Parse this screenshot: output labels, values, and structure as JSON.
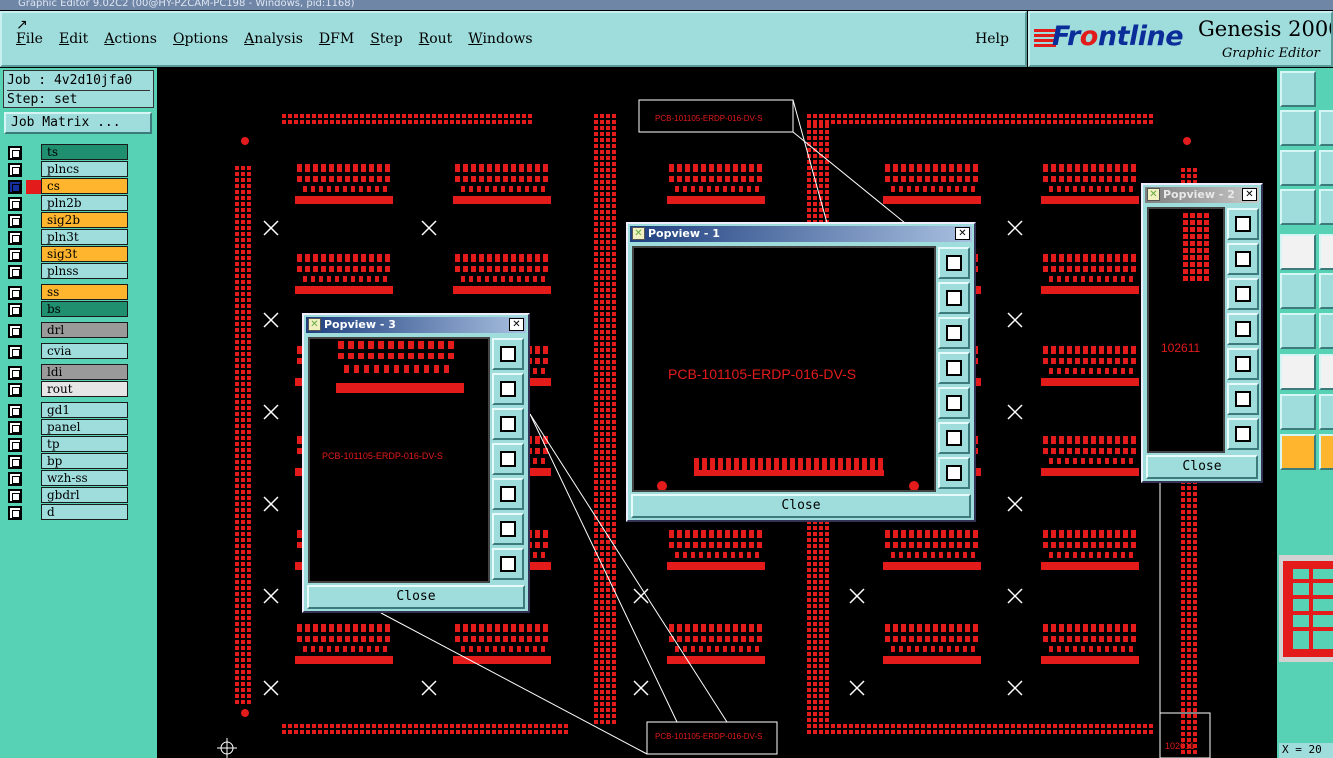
{
  "window": {
    "title": "Graphic Editor 9.02C2 (00@HY-PZCAM-PC198 - Windows, pid:1168)"
  },
  "menu": {
    "items": [
      {
        "label": "File",
        "ul": "F",
        "rest": "ile"
      },
      {
        "label": "Edit",
        "ul": "E",
        "rest": "dit"
      },
      {
        "label": "Actions",
        "ul": "A",
        "rest": "ctions"
      },
      {
        "label": "Options",
        "ul": "O",
        "rest": "ptions"
      },
      {
        "label": "Analysis",
        "ul": "A",
        "rest": "nalysis"
      },
      {
        "label": "DFM",
        "ul": "D",
        "rest": "FM"
      },
      {
        "label": "Step",
        "ul": "S",
        "rest": "tep"
      },
      {
        "label": "Rout",
        "ul": "R",
        "rest": "out"
      },
      {
        "label": "Windows",
        "ul": "W",
        "rest": "indows"
      }
    ],
    "help": "Help"
  },
  "logo": {
    "brand_pre": "Fr",
    "brand_o": "o",
    "brand_post": "ntline",
    "product": "Genesis 2000",
    "subtitle": "Graphic Editor"
  },
  "job": {
    "job_line": "Job : 4v2d10jfa0",
    "step_line": "Step: set",
    "matrix_button": "Job Matrix ..."
  },
  "layers": [
    {
      "name": "ts",
      "color": "#1f8f6f",
      "group": 1
    },
    {
      "name": "plncs",
      "color": "#9fdcdc",
      "group": 1
    },
    {
      "name": "cs",
      "color": "#ffb52e",
      "group": 1,
      "active": true
    },
    {
      "name": "pln2b",
      "color": "#9fdcdc",
      "group": 1
    },
    {
      "name": "sig2b",
      "color": "#ffb52e",
      "group": 1
    },
    {
      "name": "pln3t",
      "color": "#9fdcdc",
      "group": 1
    },
    {
      "name": "sig3t",
      "color": "#ffb52e",
      "group": 1
    },
    {
      "name": "plnss",
      "color": "#9fdcdc",
      "group": 1
    },
    {
      "name": "ss",
      "color": "#ffb52e",
      "group": 2
    },
    {
      "name": "bs",
      "color": "#1f8f6f",
      "group": 2
    },
    {
      "name": "drl",
      "color": "#9a9a9a",
      "group": 3
    },
    {
      "name": "cvia",
      "color": "#9fdcdc",
      "group": 4
    },
    {
      "name": "ldi",
      "color": "#9a9a9a",
      "group": 5
    },
    {
      "name": "rout",
      "color": "#e6e6e6",
      "group": 5
    },
    {
      "name": "gd1",
      "color": "#9fdcdc",
      "group": 6
    },
    {
      "name": "panel",
      "color": "#9fdcdc",
      "group": 6
    },
    {
      "name": "tp",
      "color": "#9fdcdc",
      "group": 6
    },
    {
      "name": "bp",
      "color": "#9fdcdc",
      "group": 6
    },
    {
      "name": "wzh-ss",
      "color": "#9fdcdc",
      "group": 6
    },
    {
      "name": "gbdrl",
      "color": "#9fdcdc",
      "group": 6
    },
    {
      "name": "d",
      "color": "#9fdcdc",
      "group": 6
    }
  ],
  "popview1": {
    "title": "Popview - 1",
    "label": "PCB-101105-ERDP-016-DV-S",
    "close": "Close"
  },
  "popview2": {
    "title": "Popview - 2",
    "label": "102611",
    "close": "Close"
  },
  "popview3": {
    "title": "Popview - 3",
    "label": "PCB-101105-ERDP-016-DV-S",
    "close": "Close"
  },
  "canvas": {
    "label_top": "PCB-101105-ERDP-016-DV-S",
    "label_bottom": "PCB-101105-ERDP-016-DV-S",
    "label_right": "102611"
  },
  "status": {
    "coord": "X = 20"
  },
  "colors": {
    "copper": "#e41b1b",
    "panel": "#58d2b5",
    "button": "#9fdcdc"
  }
}
